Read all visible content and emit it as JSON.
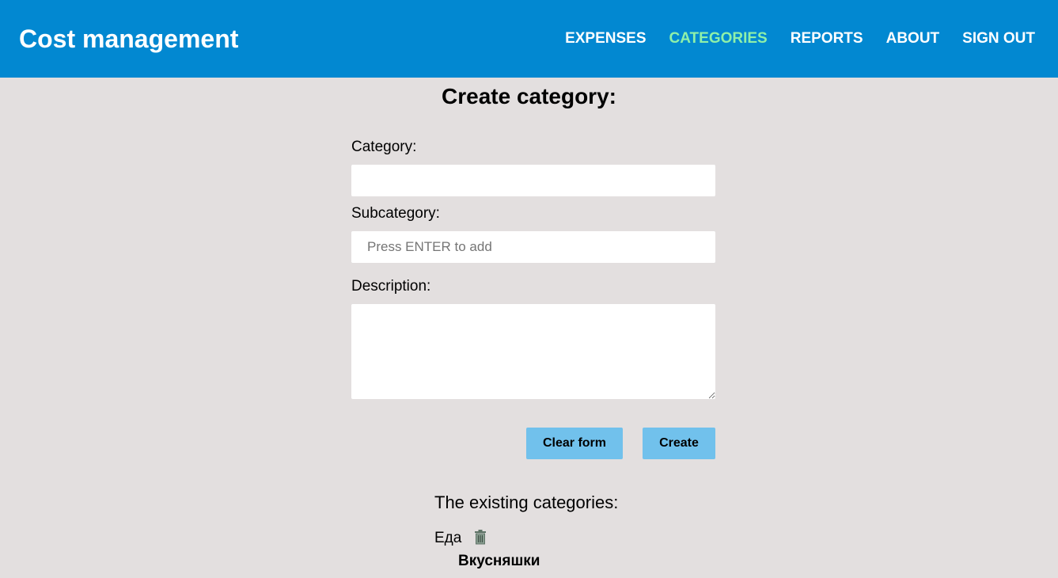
{
  "app": {
    "title": "Cost management"
  },
  "nav": {
    "items": [
      {
        "label": "EXPENSES",
        "active": false
      },
      {
        "label": "CATEGORIES",
        "active": true
      },
      {
        "label": "REPORTS",
        "active": false
      },
      {
        "label": "ABOUT",
        "active": false
      },
      {
        "label": "SIGN OUT",
        "active": false
      }
    ],
    "active_color": "#8ef0a9"
  },
  "form": {
    "title": "Create category:",
    "category_label": "Category:",
    "category_value": "",
    "subcategory_label": "Subcategory:",
    "subcategory_placeholder": "Press ENTER to add",
    "description_label": "Description:",
    "description_value": "",
    "clear_label": "Clear form",
    "create_label": "Create"
  },
  "existing": {
    "title": "The existing categories:",
    "categories": [
      {
        "name": "Еда",
        "icon": "trash-icon",
        "subcategories": [
          "Вкусняшки"
        ]
      }
    ]
  },
  "colors": {
    "header_bg": "#0288d1",
    "page_bg": "#e3dfdf",
    "button_bg": "#71c1ec",
    "icon_color": "#5e7366"
  }
}
